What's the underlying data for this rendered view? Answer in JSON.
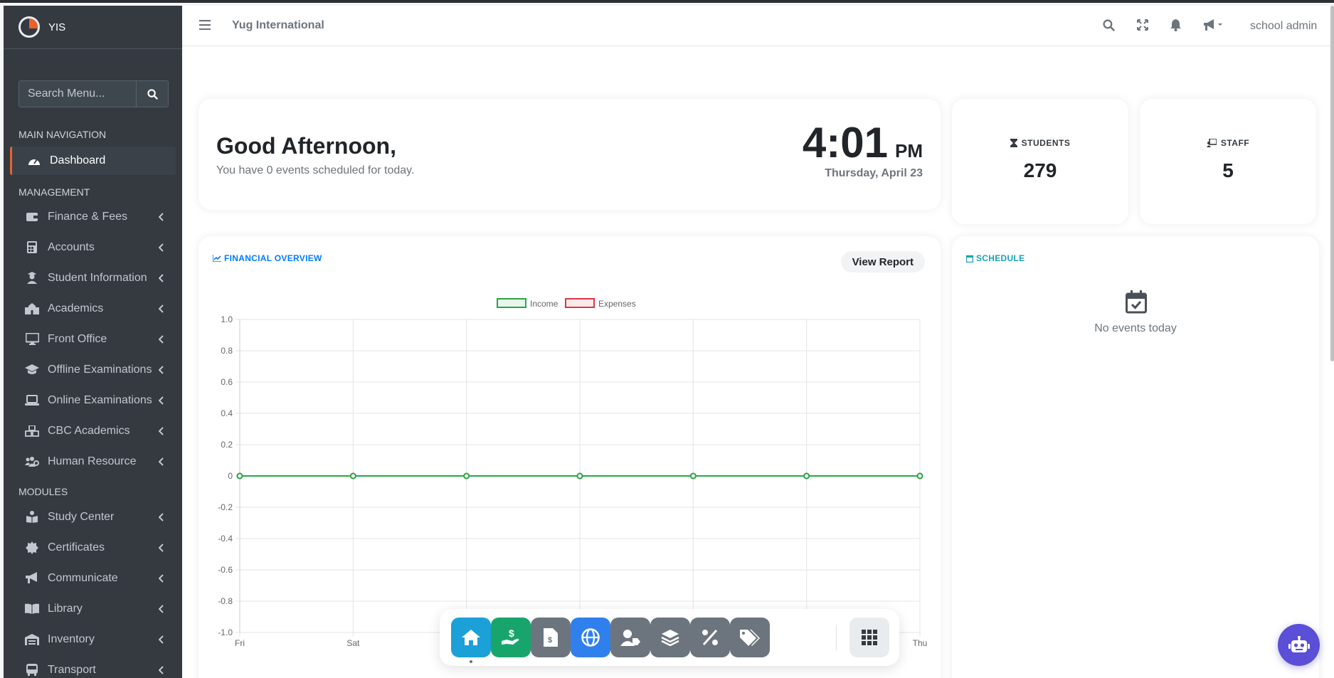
{
  "brand": {
    "name": "YIS"
  },
  "sidebar": {
    "search_placeholder": "Search Menu...",
    "sections": {
      "main": "MAIN NAVIGATION",
      "management": "MANAGEMENT",
      "modules": "MODULES"
    },
    "dashboard": "Dashboard",
    "management_items": [
      {
        "label": "Finance & Fees",
        "icon": "wallet-icon"
      },
      {
        "label": "Accounts",
        "icon": "calculator-icon"
      },
      {
        "label": "Student Information",
        "icon": "user-graduate-icon"
      },
      {
        "label": "Academics",
        "icon": "school-icon"
      },
      {
        "label": "Front Office",
        "icon": "desktop-icon"
      },
      {
        "label": "Offline Examinations",
        "icon": "graduation-cap-icon"
      },
      {
        "label": "Online Examinations",
        "icon": "laptop-icon"
      },
      {
        "label": "CBC Academics",
        "icon": "cubes-icon"
      },
      {
        "label": "Human Resource",
        "icon": "users-cog-icon"
      }
    ],
    "module_items": [
      {
        "label": "Study Center",
        "icon": "book-reader-icon"
      },
      {
        "label": "Certificates",
        "icon": "certificate-icon"
      },
      {
        "label": "Communicate",
        "icon": "bullhorn-icon"
      },
      {
        "label": "Library",
        "icon": "book-open-icon"
      },
      {
        "label": "Inventory",
        "icon": "warehouse-icon"
      },
      {
        "label": "Transport",
        "icon": "bus-icon"
      }
    ]
  },
  "topbar": {
    "title": "Yug International",
    "user": "school admin"
  },
  "greeting": {
    "title": "Good Afternoon,",
    "subtitle": "You have 0 events scheduled for today.",
    "time": "4:01",
    "ampm": "PM",
    "date": "Thursday, April 23"
  },
  "stats": {
    "students": {
      "label": "STUDENTS",
      "value": "279"
    },
    "staff": {
      "label": "STAFF",
      "value": "5"
    }
  },
  "financial": {
    "title": "FINANCIAL OVERVIEW",
    "button": "View Report"
  },
  "schedule": {
    "title": "SCHEDULE",
    "empty": "No events today"
  },
  "colors": {
    "accent": "#e8622c",
    "income": "#28a745",
    "expenses": "#dc3545",
    "primary": "#007bff",
    "info": "#17a2b8"
  },
  "dock": [
    {
      "name": "home",
      "color": "#1ba0d8"
    },
    {
      "name": "fees",
      "color": "#18a56b"
    },
    {
      "name": "invoice",
      "color": "#6c757d"
    },
    {
      "name": "online",
      "color": "#2f80ed"
    },
    {
      "name": "user-tag",
      "color": "#6c757d"
    },
    {
      "name": "layers",
      "color": "#6c757d"
    },
    {
      "name": "percent",
      "color": "#6c757d"
    },
    {
      "name": "tags",
      "color": "#6c757d"
    },
    {
      "name": "apps",
      "color": "#e9ecef"
    }
  ],
  "chart_data": {
    "type": "line",
    "categories": [
      "Fri",
      "Sat",
      "",
      "",
      "",
      "",
      "Thu"
    ],
    "series": [
      {
        "name": "Income",
        "values": [
          0,
          0,
          0,
          0,
          0,
          0,
          0
        ]
      },
      {
        "name": "Expenses",
        "values": [
          0,
          0,
          0,
          0,
          0,
          0,
          0
        ]
      }
    ],
    "yticks": [
      "1.0",
      "0.8",
      "0.6",
      "0.4",
      "0.2",
      "0",
      "-0.2",
      "-0.4",
      "-0.6",
      "-0.8",
      "-1.0"
    ],
    "ylim": [
      -1,
      1
    ],
    "grid": true,
    "legend": "top-center"
  }
}
